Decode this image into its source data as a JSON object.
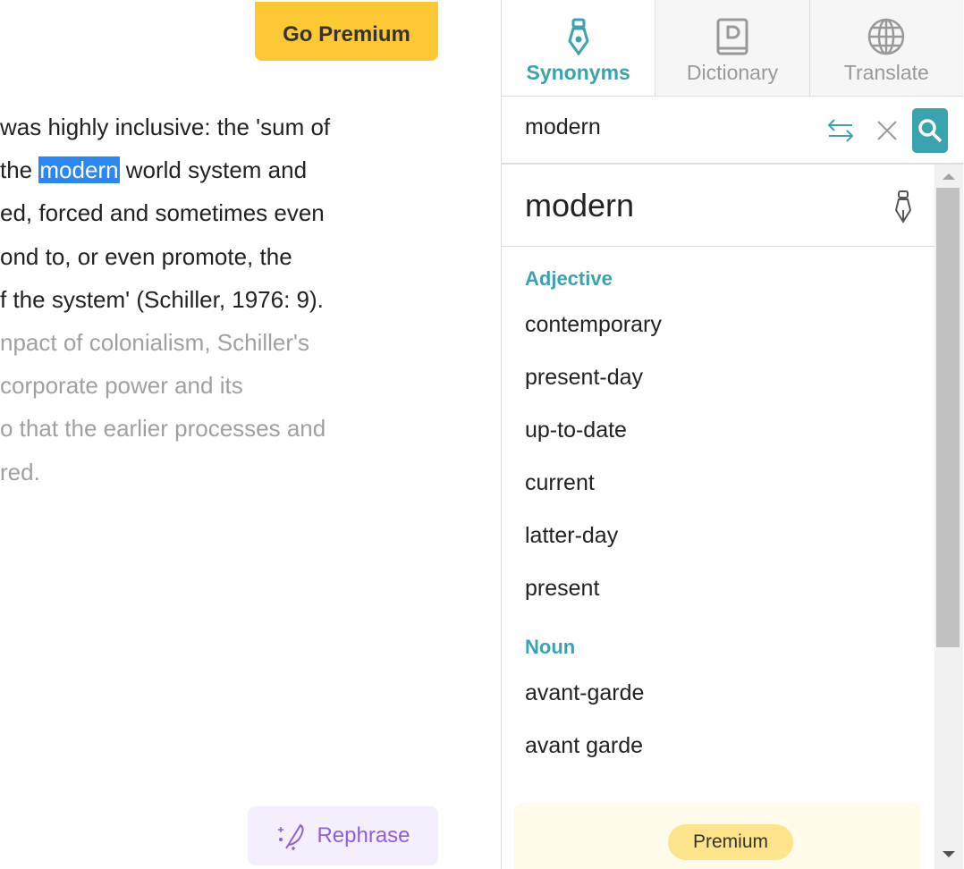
{
  "editor": {
    "premium_label": "Go Premium",
    "lines": [
      {
        "pre": "was highly inclusive: the 'sum of",
        "faded": false
      },
      {
        "pre": "the ",
        "hl": "modern",
        "post": " world system and",
        "faded": false
      },
      {
        "pre": "ed, forced and sometimes even",
        "faded": false
      },
      {
        "pre": "ond to, or even promote, the",
        "faded": false
      },
      {
        "pre": "f the system' (Schiller, 1976: 9).",
        "faded": false
      },
      {
        "pre": "npact of colonialism, Schiller's",
        "faded": true
      },
      {
        "pre": "corporate power and its",
        "faded": true
      },
      {
        "pre": "o that the earlier processes and",
        "faded": true
      },
      {
        "pre": "red.",
        "faded": true
      }
    ],
    "rephrase_label": "Rephrase"
  },
  "panel": {
    "tabs": [
      {
        "label": "Synonyms",
        "icon": "pen-nib-icon",
        "active": true
      },
      {
        "label": "Dictionary",
        "icon": "book-icon",
        "active": false
      },
      {
        "label": "Translate",
        "icon": "globe-icon",
        "active": false
      }
    ],
    "search_value": "modern",
    "headword": "modern",
    "groups": [
      {
        "pos": "Adjective",
        "words": [
          "contemporary",
          "present-day",
          "up-to-date",
          "current",
          "latter-day",
          "present"
        ]
      },
      {
        "pos": "Noun",
        "words": [
          "avant-garde",
          "avant garde"
        ]
      }
    ],
    "premium_badge": "Premium"
  },
  "colors": {
    "accent": "#3aa3b0",
    "premium": "#fcc934",
    "highlight": "#2b87f5",
    "rephrase": "#8e5fd8"
  }
}
